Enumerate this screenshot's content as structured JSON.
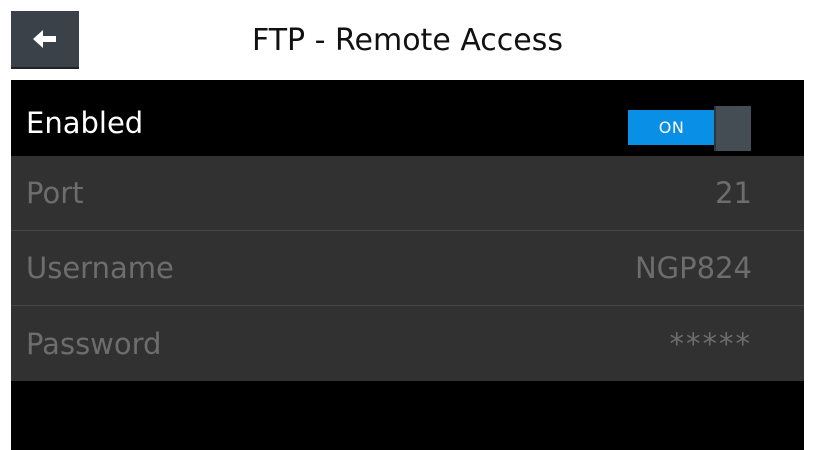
{
  "header": {
    "title": "FTP - Remote Access",
    "back_icon": "arrow-left-icon"
  },
  "settings": {
    "enabled": {
      "label": "Enabled",
      "toggle_state": "ON"
    },
    "port": {
      "label": "Port",
      "value": "21"
    },
    "username": {
      "label": "Username",
      "value": "NGP824"
    },
    "password": {
      "label": "Password",
      "value": "*****"
    }
  },
  "colors": {
    "toggle_on": "#0a8fe6",
    "panel_bg": "#000000",
    "row_bg": "#313131",
    "dim_text": "#6d6d6d"
  }
}
